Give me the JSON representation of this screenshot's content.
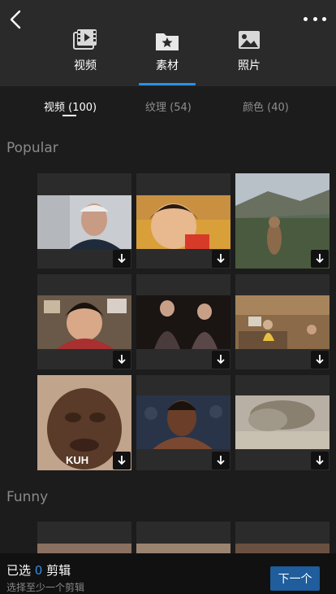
{
  "nav": {
    "back_icon": "back-chevron-icon",
    "more_icon": "more-dots-icon"
  },
  "tabs": [
    {
      "label": "视频",
      "icon": "film-icon",
      "active": false
    },
    {
      "label": "素材",
      "icon": "star-folder-icon",
      "active": true
    },
    {
      "label": "照片",
      "icon": "photo-icon",
      "active": false
    }
  ],
  "subtabs": [
    {
      "label": "视频 (100)",
      "active": true
    },
    {
      "label": "纹理 (54)",
      "active": false
    },
    {
      "label": "颜色 (40)",
      "active": false
    }
  ],
  "sections": [
    {
      "title": "Popular",
      "items": [
        {
          "thumb": "man-smiling",
          "overlay_text": ""
        },
        {
          "thumb": "kid-face",
          "overlay_text": ""
        },
        {
          "thumb": "marmot-mountains",
          "overlay_text": ""
        },
        {
          "thumb": "man-laughing-room",
          "overlay_text": ""
        },
        {
          "thumb": "two-women-dark",
          "overlay_text": ""
        },
        {
          "thumb": "office-room",
          "overlay_text": ""
        },
        {
          "thumb": "crying-face",
          "overlay_text": "KUH"
        },
        {
          "thumb": "wrestler-smile",
          "overlay_text": ""
        },
        {
          "thumb": "explosion-dust",
          "overlay_text": ""
        }
      ]
    },
    {
      "title": "Funny",
      "items": []
    }
  ],
  "bottom": {
    "selected_prefix": "已选 ",
    "selected_count": "0",
    "selected_suffix": " 剪辑",
    "hint": "选择至少一个剪辑",
    "next_label": "下一个"
  },
  "colors": {
    "accent": "#2f8fe6",
    "next_button": "#1f5d9c",
    "background": "#1c1c1c"
  }
}
